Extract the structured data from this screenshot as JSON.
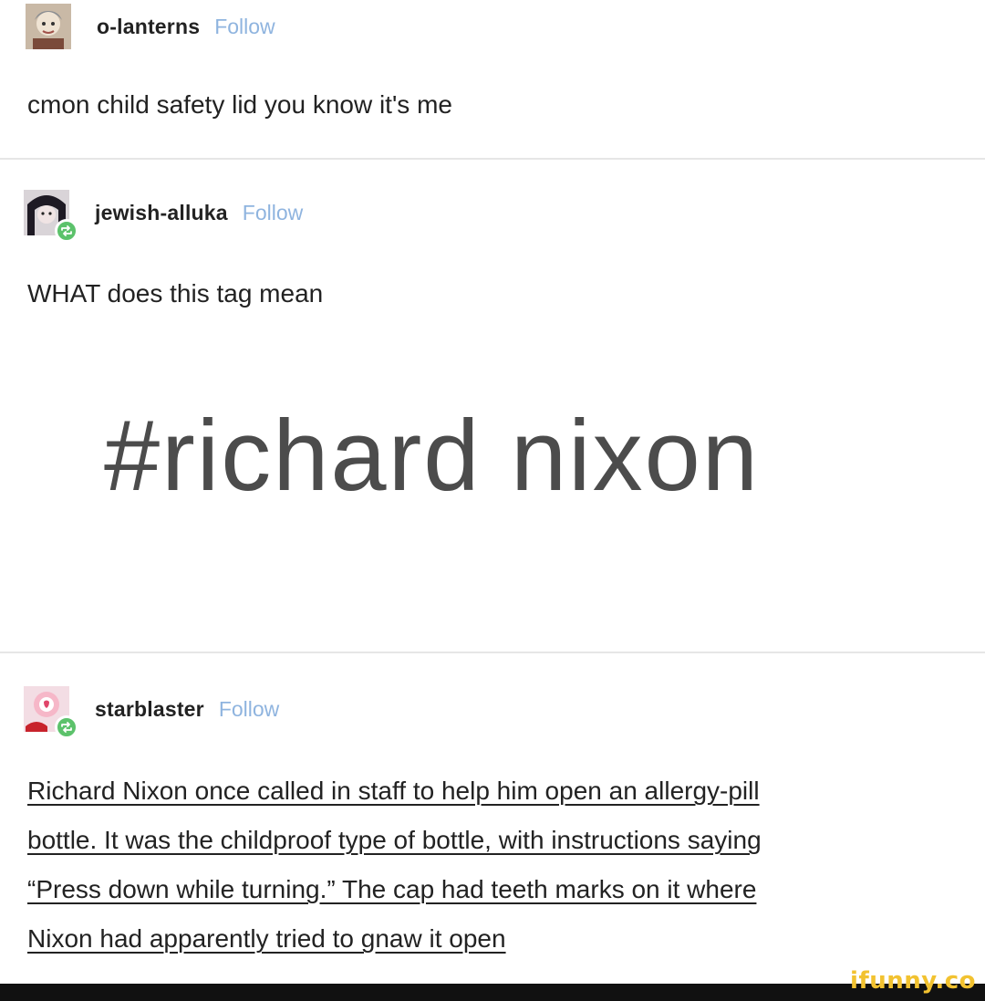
{
  "posts": [
    {
      "username": "o-lanterns",
      "follow_label": "Follow",
      "text": "cmon child safety lid you know it's me"
    },
    {
      "username": "jewish-alluka",
      "follow_label": "Follow",
      "text": "WHAT does this tag mean",
      "tag": "#richard nixon"
    },
    {
      "username": "starblaster",
      "follow_label": "Follow",
      "text_lines": [
        "Richard Nixon once called in staff to help him open an allergy-pill",
        "bottle. It was the childproof type of bottle, with instructions saying",
        "“Press down while turning.” The cap had teeth marks on it where",
        "Nixon had apparently tried to gnaw it open"
      ]
    }
  ],
  "watermark": "ifunny.co",
  "colors": {
    "follow": "#8fb4df",
    "reblog_badge": "#5cc26b",
    "tag_text": "#4c4c4c",
    "watermark": "#f2c230"
  },
  "icons": {
    "reblog": "reblog-icon"
  }
}
